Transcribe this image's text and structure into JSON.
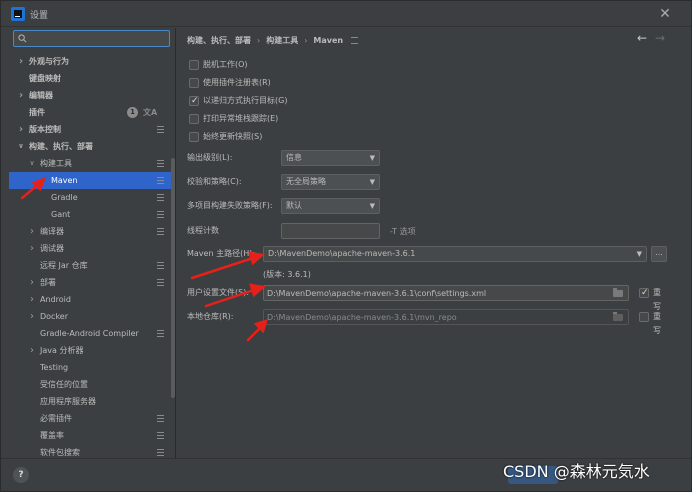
{
  "window": {
    "title": "设置",
    "close_glyph": "✕"
  },
  "sidebar": {
    "search_placeholder": "",
    "search_value": "",
    "items": [
      {
        "label": "外观与行为",
        "level": 0,
        "arrow": "right",
        "bold": true,
        "icon": false
      },
      {
        "label": "键盘映射",
        "level": 0,
        "arrow": "",
        "bold": true,
        "icon": false
      },
      {
        "label": "编辑器",
        "level": 0,
        "arrow": "right",
        "bold": true,
        "icon": false
      },
      {
        "label": "插件",
        "level": 0,
        "arrow": "",
        "bold": true,
        "icon": false,
        "badge": "1"
      },
      {
        "label": "版本控制",
        "level": 0,
        "arrow": "right",
        "bold": true,
        "icon": true
      },
      {
        "label": "构建、执行、部署",
        "level": 0,
        "arrow": "down",
        "bold": true,
        "icon": false
      },
      {
        "label": "构建工具",
        "level": 1,
        "arrow": "down",
        "bold": false,
        "icon": true
      },
      {
        "label": "Maven",
        "level": 2,
        "arrow": "right",
        "bold": false,
        "icon": true,
        "selected": true
      },
      {
        "label": "Gradle",
        "level": 2,
        "arrow": "",
        "bold": false,
        "icon": true
      },
      {
        "label": "Gant",
        "level": 2,
        "arrow": "",
        "bold": false,
        "icon": true
      },
      {
        "label": "编译器",
        "level": 1,
        "arrow": "right",
        "bold": false,
        "icon": true
      },
      {
        "label": "调试器",
        "level": 1,
        "arrow": "right",
        "bold": false,
        "icon": false
      },
      {
        "label": "远程 Jar 仓库",
        "level": 1,
        "arrow": "",
        "bold": false,
        "icon": true
      },
      {
        "label": "部署",
        "level": 1,
        "arrow": "right",
        "bold": false,
        "icon": true
      },
      {
        "label": "Android",
        "level": 1,
        "arrow": "right",
        "bold": false,
        "icon": false
      },
      {
        "label": "Docker",
        "level": 1,
        "arrow": "right",
        "bold": false,
        "icon": false
      },
      {
        "label": "Gradle-Android Compiler",
        "level": 1,
        "arrow": "",
        "bold": false,
        "icon": true
      },
      {
        "label": "Java 分析器",
        "level": 1,
        "arrow": "right",
        "bold": false,
        "icon": false
      },
      {
        "label": "Testing",
        "level": 1,
        "arrow": "",
        "bold": false,
        "icon": false
      },
      {
        "label": "受信任的位置",
        "level": 1,
        "arrow": "",
        "bold": false,
        "icon": false
      },
      {
        "label": "应用程序服务器",
        "level": 1,
        "arrow": "",
        "bold": false,
        "icon": false
      },
      {
        "label": "必需插件",
        "level": 1,
        "arrow": "",
        "bold": false,
        "icon": true
      },
      {
        "label": "覆盖率",
        "level": 1,
        "arrow": "",
        "bold": false,
        "icon": true
      },
      {
        "label": "软件包搜索",
        "level": 1,
        "arrow": "",
        "bold": false,
        "icon": true
      }
    ]
  },
  "breadcrumb": {
    "parts": [
      "构建、执行、部署",
      "构建工具",
      "Maven"
    ],
    "separator": "›"
  },
  "nav": {
    "back": "←",
    "forward": "→"
  },
  "checkboxes": [
    {
      "label": "脱机工作(O)",
      "checked": false
    },
    {
      "label": "使用插件注册表(R)",
      "checked": false
    },
    {
      "label": "以递归方式执行目标(G)",
      "checked": true
    },
    {
      "label": "打印异常堆栈跟踪(E)",
      "checked": false
    },
    {
      "label": "始终更新快照(S)",
      "checked": false
    }
  ],
  "form": {
    "output_level": {
      "label": "输出级别(L):",
      "value": "信息"
    },
    "checksum_policy": {
      "label": "校验和策略(C):",
      "value": "无全局策略"
    },
    "multiproject_fail": {
      "label": "多项目构建失败策略(F):",
      "value": "默认"
    },
    "thread_count": {
      "label": "线程计数",
      "value": "",
      "hint": "-T 选项"
    },
    "maven_home": {
      "label": "Maven 主路径(H):",
      "value": "D:\\MavenDemo\\apache-maven-3.6.1",
      "browse": "...",
      "version": "(版本: 3.6.1)"
    },
    "user_settings": {
      "label": "用户设置文件(S):",
      "value": "D:\\MavenDemo\\apache-maven-3.6.1\\conf\\settings.xml",
      "override_label": "重写",
      "override_checked": true
    },
    "local_repo": {
      "label": "本地仓库(R):",
      "value": "D:\\MavenDemo\\apache-maven-3.6.1\\mvn_repo",
      "override_label": "重写",
      "override_checked": false
    }
  },
  "footer": {
    "help": "?"
  },
  "watermark": "CSDN @森林元気水",
  "colors": {
    "selection": "#2f65ca",
    "annotation_arrow": "#e8201a",
    "background": "#3c3f41"
  }
}
